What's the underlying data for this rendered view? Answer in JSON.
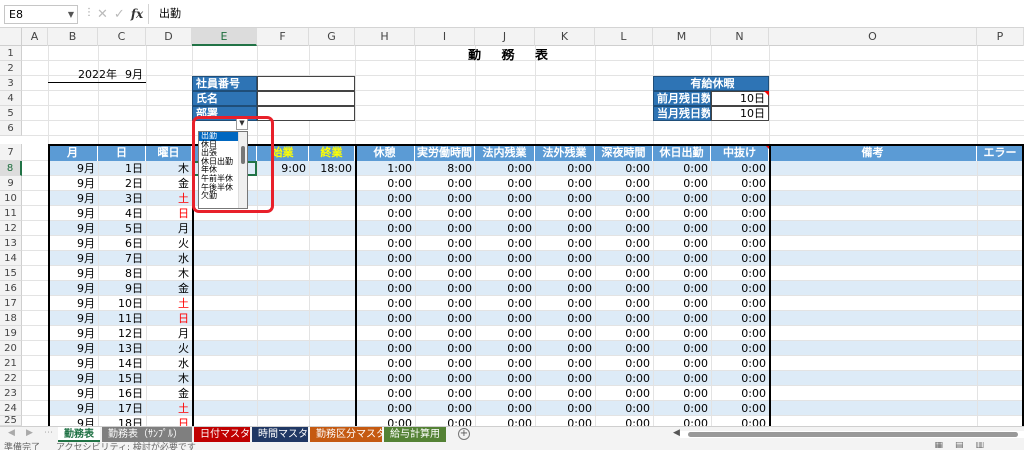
{
  "formula_bar": {
    "name_box": "E8",
    "fx_label": "fx",
    "formula": "出勤"
  },
  "columns": [
    "A",
    "B",
    "C",
    "D",
    "E",
    "F",
    "G",
    "H",
    "I",
    "J",
    "K",
    "L",
    "M",
    "N",
    "O",
    "P"
  ],
  "selected_column": "E",
  "selected_row": 8,
  "rows": [
    1,
    2,
    3,
    4,
    5,
    6,
    7,
    8,
    9,
    10,
    11,
    12,
    13,
    14,
    15,
    16,
    17,
    18,
    19,
    20,
    21,
    22,
    23,
    24,
    25
  ],
  "sheet": {
    "title": "勤 務 表",
    "year": "2022年",
    "month": "9月",
    "employee_info": [
      {
        "label": "社員番号",
        "value": ""
      },
      {
        "label": "氏名",
        "value": ""
      },
      {
        "label": "部署",
        "value": ""
      }
    ],
    "paid_leave": {
      "title": "有給休暇",
      "rows": [
        {
          "label": "前月残日数",
          "value": "10日"
        },
        {
          "label": "当月残日数",
          "value": "10日"
        }
      ]
    },
    "headers": [
      "月",
      "日",
      "曜日",
      "勤務状況",
      "始業",
      "終業",
      "休憩",
      "実労働時間",
      "法内残業",
      "法外残業",
      "深夜時間",
      "休日出勤",
      "中抜け",
      "備考",
      "エラー"
    ],
    "first_row": {
      "status": "出勤",
      "start": "9:00",
      "end": "18:00",
      "break": "1:00",
      "work": "8:00"
    },
    "zero_time": "0:00",
    "days": [
      {
        "m": "9月",
        "d": "1日",
        "w": "木"
      },
      {
        "m": "9月",
        "d": "2日",
        "w": "金"
      },
      {
        "m": "9月",
        "d": "3日",
        "w": "土"
      },
      {
        "m": "9月",
        "d": "4日",
        "w": "日"
      },
      {
        "m": "9月",
        "d": "5日",
        "w": "月"
      },
      {
        "m": "9月",
        "d": "6日",
        "w": "火"
      },
      {
        "m": "9月",
        "d": "7日",
        "w": "水"
      },
      {
        "m": "9月",
        "d": "8日",
        "w": "木"
      },
      {
        "m": "9月",
        "d": "9日",
        "w": "金"
      },
      {
        "m": "9月",
        "d": "10日",
        "w": "土"
      },
      {
        "m": "9月",
        "d": "11日",
        "w": "日"
      },
      {
        "m": "9月",
        "d": "12日",
        "w": "月"
      },
      {
        "m": "9月",
        "d": "13日",
        "w": "火"
      },
      {
        "m": "9月",
        "d": "14日",
        "w": "水"
      },
      {
        "m": "9月",
        "d": "15日",
        "w": "木"
      },
      {
        "m": "9月",
        "d": "16日",
        "w": "金"
      },
      {
        "m": "9月",
        "d": "17日",
        "w": "土"
      },
      {
        "m": "9月",
        "d": "18日",
        "w": "日"
      }
    ]
  },
  "dropdown": {
    "selected": "出勤",
    "options": [
      "出勤",
      "休日",
      "出張",
      "休日出勤",
      "年休",
      "午前半休",
      "午後半休",
      "欠勤"
    ]
  },
  "tabs": [
    {
      "label": "勤務表",
      "bg": "#ffffff",
      "fg": "#217346",
      "active": true
    },
    {
      "label": "勤務表（ｻﾝﾌﾟﾙ）",
      "bg": "#7f7f7f",
      "fg": "#ffffff",
      "active": false
    },
    {
      "label": "日付マスタ",
      "bg": "#c00000",
      "fg": "#ffffff",
      "active": false
    },
    {
      "label": "時間マスタ",
      "bg": "#203864",
      "fg": "#ffffff",
      "active": false
    },
    {
      "label": "勤務区分マスタ",
      "bg": "#c55a11",
      "fg": "#ffffff",
      "active": false
    },
    {
      "label": "給与計算用",
      "bg": "#548235",
      "fg": "#ffffff",
      "active": false
    }
  ],
  "status": {
    "ready": "準備完了",
    "accessibility": "アクセシビリティ: 検討が必要です"
  },
  "colors": {
    "weekend_red": "#ff0000",
    "header_blue": "#5b9bd5",
    "label_blue": "#2e74b5",
    "band": "#ddebf7"
  }
}
